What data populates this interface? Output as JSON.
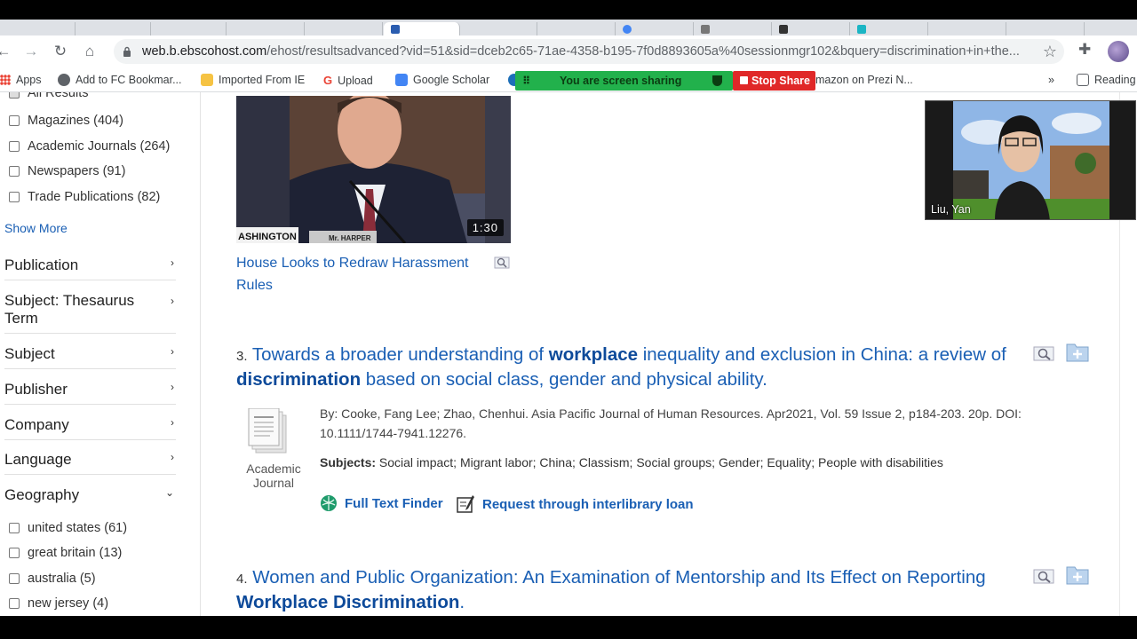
{
  "browser": {
    "url_host": "web.b.ebscohost.com",
    "url_rest": "/ehost/resultsadvanced?vid=51&sid=dceb2c65-71ae-4358-b195-7f0d8893605a%40sessionmgr102&bquery=discrimination+in+the...",
    "bookmarks": [
      {
        "label": "Apps",
        "color": "#4285f4"
      },
      {
        "label": "Add to FC Bookmar...",
        "color": "#5f6368"
      },
      {
        "label": "Imported From IE",
        "color": "#f6c343"
      },
      {
        "label": "Upload",
        "color": "#ea4335"
      },
      {
        "label": "Google Scholar",
        "color": "#4285f4"
      },
      {
        "label": "mazon on Prezi N...",
        "color": "#ffffff"
      },
      {
        "label": "Reading",
        "color": "#5f6368"
      }
    ],
    "more_bookmarks": "»"
  },
  "screen_share": {
    "status_text": "You are screen sharing",
    "stop_label": "Stop Share"
  },
  "sidebar": {
    "top_partial": "All Results",
    "source_types": [
      {
        "label": "Magazines (404)"
      },
      {
        "label": "Academic Journals (264)"
      },
      {
        "label": "Newspapers (91)"
      },
      {
        "label": "Trade Publications (82)"
      }
    ],
    "show_more": "Show More",
    "facets": [
      {
        "label": "Publication",
        "arrow": "›"
      },
      {
        "label": "Subject: Thesaurus Term",
        "arrow": "›"
      },
      {
        "label": "Subject",
        "arrow": "›"
      },
      {
        "label": "Publisher",
        "arrow": "›"
      },
      {
        "label": "Company",
        "arrow": "›"
      },
      {
        "label": "Language",
        "arrow": "›"
      },
      {
        "label": "Geography",
        "arrow": "⌄"
      }
    ],
    "geography": [
      {
        "label": "united states (61)"
      },
      {
        "label": "great britain (13)"
      },
      {
        "label": "australia (5)"
      },
      {
        "label": "new jersey (4)"
      }
    ]
  },
  "video": {
    "duration": "1:30",
    "caption_left": "ASHINGTON",
    "nameplate": "Mr. HARPER",
    "title": "House Looks to Redraw Harassment Rules"
  },
  "results": [
    {
      "number": "3.",
      "title_parts": [
        {
          "text": "Towards a broader understanding of ",
          "bold": false
        },
        {
          "text": "workplace",
          "bold": true
        },
        {
          "text": " inequality and exclusion in China: a review of ",
          "bold": false
        },
        {
          "text": "discrimination",
          "bold": true
        },
        {
          "text": " based on social class, gender and physical ability.",
          "bold": false
        }
      ],
      "byline": "By: Cooke, Fang Lee; Zhao, Chenhui. Asia Pacific Journal of Human Resources. Apr2021, Vol. 59 Issue 2, p184-203. 20p. DOI: 10.1111/1744-7941.12276.",
      "subjects_label": "Subjects:",
      "subjects": "Social impact; Migrant labor; China; Classism; Social groups; Gender; Equality; People with disabilities",
      "doc_type": "Academic Journal",
      "full_text_finder": "Full Text Finder",
      "ill": "Request through interlibrary loan"
    },
    {
      "number": "4.",
      "title_parts": [
        {
          "text": "Women and Public Organization: An Examination of Mentorship and Its Effect on Reporting ",
          "bold": false
        },
        {
          "text": "Workplace Discrimination",
          "bold": true
        },
        {
          "text": ".",
          "bold": false
        }
      ]
    }
  ],
  "webcam": {
    "name": "Liu, Yan"
  }
}
